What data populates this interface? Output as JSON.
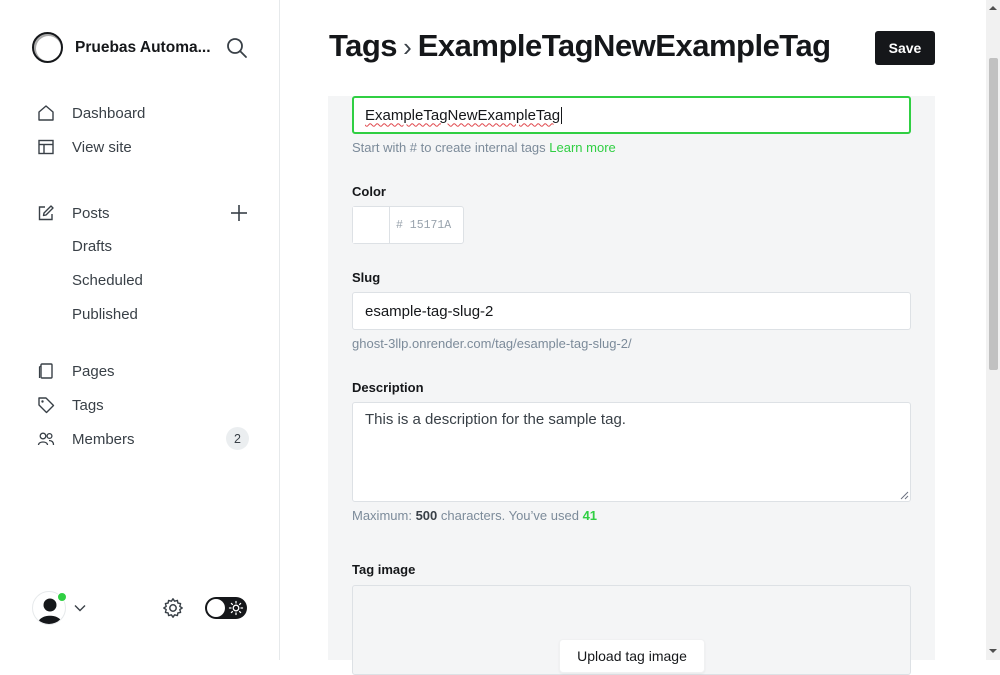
{
  "sidebar": {
    "site_name": "Pruebas Automa...",
    "nav": {
      "dashboard": "Dashboard",
      "view_site": "View site",
      "posts": "Posts",
      "drafts": "Drafts",
      "scheduled": "Scheduled",
      "published": "Published",
      "pages": "Pages",
      "tags": "Tags",
      "members": "Members",
      "members_count": "2"
    }
  },
  "header": {
    "breadcrumb_parent": "Tags",
    "breadcrumb_separator": "›",
    "title": "ExampleTagNewExampleTag",
    "save_label": "Save"
  },
  "form": {
    "name_value": "ExampleTagNewExampleTag",
    "name_hint": "Start with # to create internal tags",
    "name_hint_link": "Learn more",
    "color_label": "Color",
    "color_value": "# 15171A",
    "slug_label": "Slug",
    "slug_value": "esample-tag-slug-2",
    "slug_url": "ghost-3llp.onrender.com/tag/esample-tag-slug-2/",
    "description_label": "Description",
    "description_value": "This is a description for the sample tag.",
    "desc_hint_prefix": "Maximum:",
    "desc_hint_max": "500",
    "desc_hint_middle": "characters. You’ve used",
    "desc_hint_used": "41",
    "tag_image_label": "Tag image",
    "upload_label": "Upload tag image"
  },
  "colors": {
    "accent": "#30cf43",
    "dark": "#15171a",
    "panel": "#f4f5f6"
  }
}
